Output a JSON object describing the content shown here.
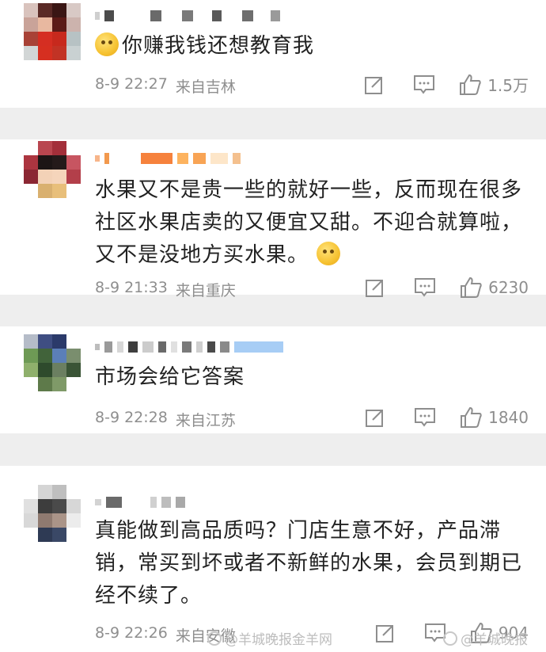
{
  "comments": [
    {
      "text": "你赚我钱还想教育我",
      "date": "8-9 22:27",
      "location": "来自吉林",
      "likes": "1.5万",
      "emoji_before": "crying-face"
    },
    {
      "text": "水果又不是贵一些的就好一些，反而现在很多社区水果店卖的又便宜又甜。不迎合就算啦，又不是没地方买水果。",
      "date": "8-9 21:33",
      "location": "来自重庆",
      "likes": "6230",
      "emoji_after": "thinking-face"
    },
    {
      "text": "市场会给它答案",
      "date": "8-9 22:28",
      "location": "来自江苏",
      "likes": "1840"
    },
    {
      "text": "真能做到高品质吗？门店生意不好，产品滞销，常买到坏或者不新鲜的水果，会员到期已经不续了。",
      "date": "8-9 22:26",
      "location": "来自安徽",
      "likes": "904"
    }
  ],
  "watermarks": [
    "@羊城晚报金羊网",
    "@羊城晚报"
  ],
  "colors": {
    "meta_text": "#8e8e8e",
    "body_text": "#222222",
    "background": "#eeeeee"
  }
}
